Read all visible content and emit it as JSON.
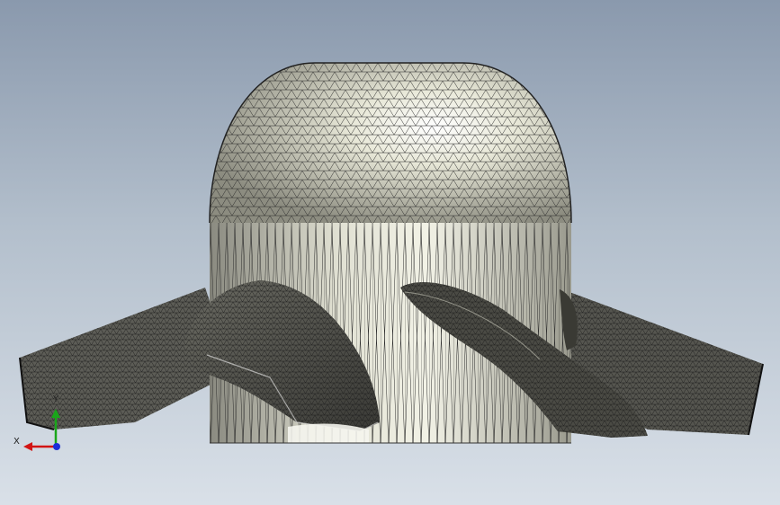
{
  "viewport": {
    "background_top": "#8a99ad",
    "background_bottom": "#d9e0e8"
  },
  "model": {
    "surface_color": "#e6e6d6",
    "mesh_color": "#2a2a2a",
    "shadow_color": "#2e2e2e",
    "highlight_color": "#ffffff"
  },
  "triad": {
    "x_label": "X",
    "y_label": "Y",
    "x_color": "#d21414",
    "y_color": "#1aa61a",
    "z_color": "#1c2dd8"
  }
}
